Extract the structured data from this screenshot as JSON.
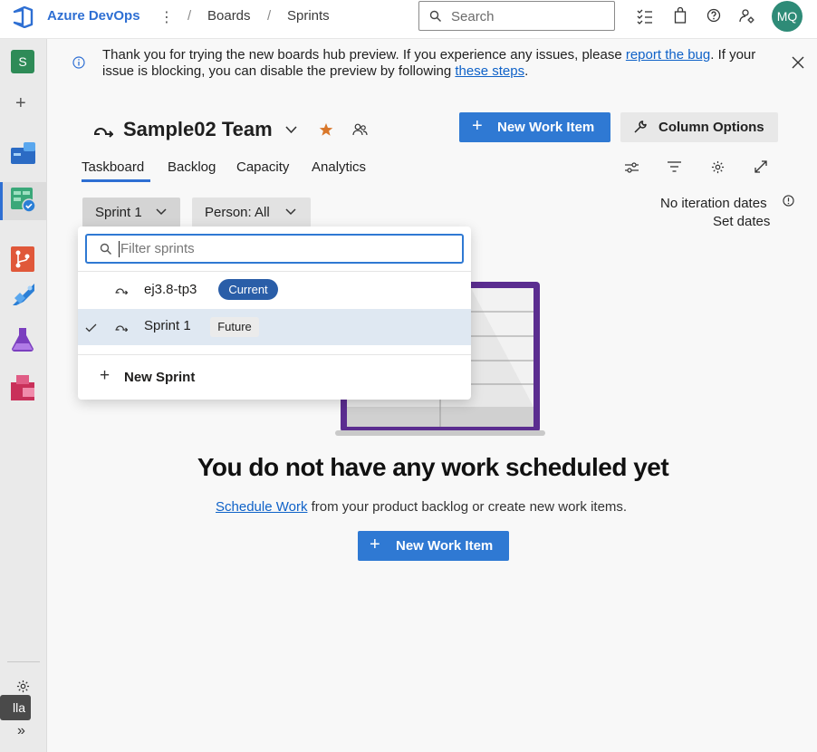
{
  "app": {
    "brand": "Azure DevOps",
    "breadcrumbs": [
      "Boards",
      "Sprints"
    ],
    "search_placeholder": "Search",
    "avatar_initials": "MQ",
    "project_initial": "S"
  },
  "banner": {
    "text_before": "Thank you for trying the new boards hub preview. If you experience any issues, please ",
    "link1": "report the bug",
    "text_middle": ". If your issue is blocking, you can disable the preview by following ",
    "link2": "these steps",
    "text_after": "."
  },
  "team": {
    "name": "Sample02 Team"
  },
  "actions": {
    "new_work_item": "New Work Item",
    "column_options": "Column Options"
  },
  "tabs": [
    {
      "label": "Taskboard",
      "active": true
    },
    {
      "label": "Backlog"
    },
    {
      "label": "Capacity"
    },
    {
      "label": "Analytics"
    }
  ],
  "filters": {
    "sprint": "Sprint 1",
    "person": "Person: All"
  },
  "iteration": {
    "no_dates": "No iteration dates",
    "set_dates": "Set dates"
  },
  "sprint_dropdown": {
    "filter_placeholder": "Filter sprints",
    "items": [
      {
        "name": "ej3.8-tp3",
        "badge": "Current",
        "selected": false
      },
      {
        "name": "Sprint 1",
        "badge": "Future",
        "selected": true
      }
    ],
    "new_sprint": "New Sprint"
  },
  "empty_state": {
    "title": "You do not have any work scheduled yet",
    "link": "Schedule Work",
    "rest": " from your product backlog or create new work items.",
    "button": "New Work Item"
  },
  "tooltip": "lla",
  "colors": {
    "primary": "#2f79d3",
    "brand": "#2e6fd3",
    "illustration_frame": "#5b2d90",
    "current_badge": "#2a5ea8",
    "avatar": "#2e8b77"
  }
}
